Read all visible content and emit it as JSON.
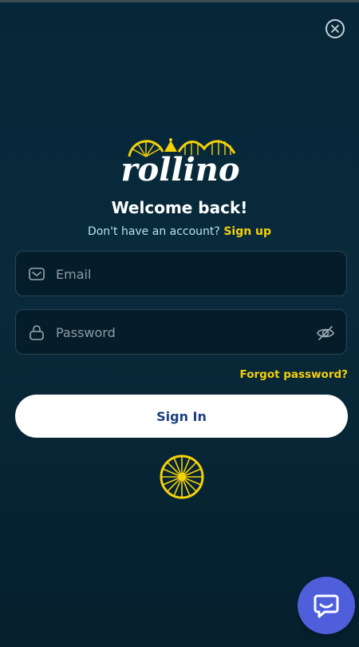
{
  "brand": {
    "name": "rollino",
    "accent": "#f5d10a",
    "background": "#082a3b"
  },
  "icons": {
    "close": "close-icon",
    "email": "envelope-icon",
    "password": "lock-icon",
    "visibility": "eye-off-icon",
    "loader": "wheel-icon",
    "chat": "chat-bubble-icon"
  },
  "login": {
    "title": "Welcome back!",
    "signup_prompt": "Don't have an account?",
    "signup_link": "Sign up",
    "email_value": "",
    "email_placeholder": "Email",
    "password_value": "",
    "password_placeholder": "Password",
    "forgot_link": "Forgot password?",
    "submit_label": "Sign In"
  }
}
